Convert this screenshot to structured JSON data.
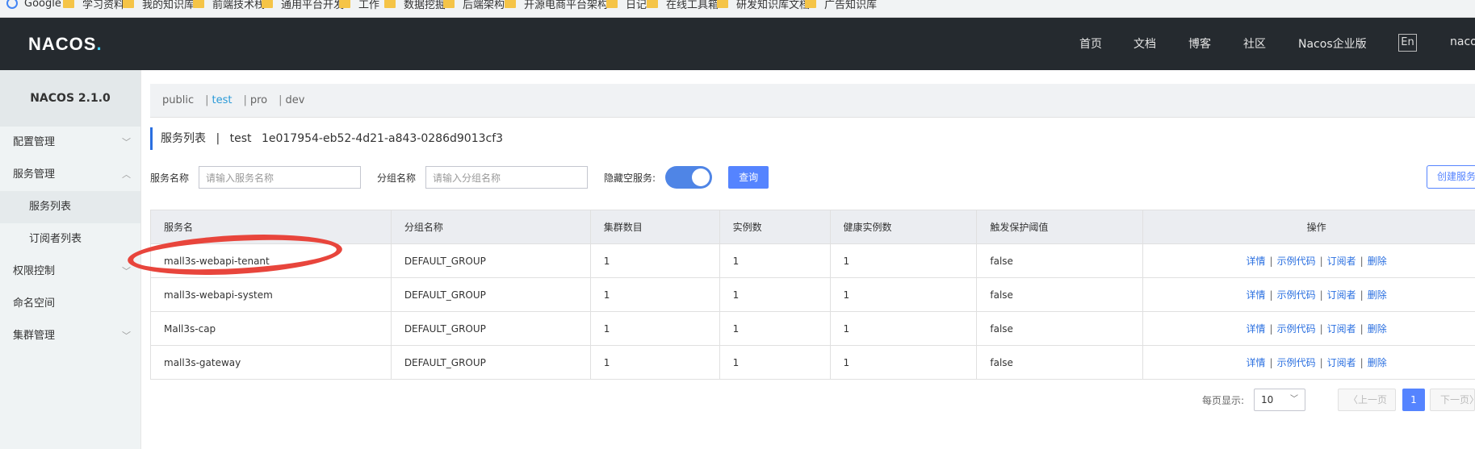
{
  "bookmarks": [
    "Google",
    "学习资料",
    "我的知识库",
    "前端技术栈",
    "通用平台开发",
    "工作",
    "数据挖掘",
    "后端架构",
    "开源电商平台架构...",
    "日记",
    "在线工具箱",
    "研发知识库文档",
    "广告知识库"
  ],
  "header": {
    "logo": "NACOS",
    "logo_dot": ".",
    "nav": [
      "首页",
      "文档",
      "博客",
      "社区",
      "Nacos企业版"
    ],
    "lang": "En",
    "user": "nacos"
  },
  "sidebar": {
    "version": "NACOS 2.1.0",
    "items": [
      {
        "label": "配置管理",
        "chevron": "chevron-down"
      },
      {
        "label": "服务管理",
        "chevron": "chevron-up"
      },
      {
        "label": "服务列表",
        "sub": true
      },
      {
        "label": "订阅者列表",
        "sub": true
      },
      {
        "label": "权限控制",
        "chevron": "chevron-down"
      },
      {
        "label": "命名空间"
      },
      {
        "label": "集群管理",
        "chevron": "chevron-down"
      }
    ]
  },
  "namespaces": [
    "public",
    "test",
    "pro",
    "dev"
  ],
  "active_namespace": "test",
  "page": {
    "title": "服务列表",
    "sep": "|",
    "ns_name": "test",
    "ns_id": "1e017954-eb52-4d21-a843-0286d9013cf3"
  },
  "filters": {
    "service_label": "服务名称",
    "service_placeholder": "请输入服务名称",
    "group_label": "分组名称",
    "group_placeholder": "请输入分组名称",
    "hide_empty_label": "隐藏空服务:",
    "query": "查询",
    "create": "创建服务"
  },
  "table": {
    "headers": [
      "服务名",
      "分组名称",
      "集群数目",
      "实例数",
      "健康实例数",
      "触发保护阈值",
      "操作"
    ],
    "rows": [
      [
        "mall3s-webapi-tenant",
        "DEFAULT_GROUP",
        "1",
        "1",
        "1",
        "false"
      ],
      [
        "mall3s-webapi-system",
        "DEFAULT_GROUP",
        "1",
        "1",
        "1",
        "false"
      ],
      [
        "Mall3s-cap",
        "DEFAULT_GROUP",
        "1",
        "1",
        "1",
        "false"
      ],
      [
        "mall3s-gateway",
        "DEFAULT_GROUP",
        "1",
        "1",
        "1",
        "false"
      ]
    ],
    "actions": [
      "详情",
      "示例代码",
      "订阅者",
      "删除"
    ]
  },
  "pagination": {
    "per_page_label": "每页显示:",
    "per_page": "10",
    "prev": "上一页",
    "current": "1",
    "next": "下一页"
  },
  "colors": {
    "accent": "#5584ff",
    "header_bg": "#252a2f",
    "annotation": "#e8453c"
  }
}
